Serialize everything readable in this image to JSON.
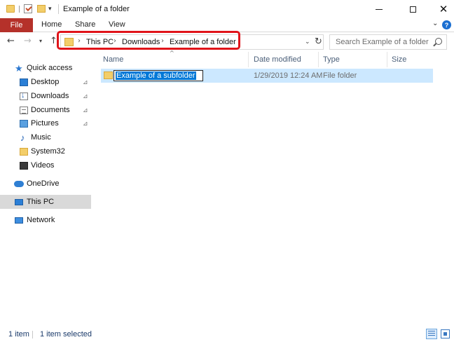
{
  "window": {
    "title": "Example of a folder",
    "minimize_icon": "minimize-icon",
    "maximize_icon": "maximize-icon",
    "close_glyph": "✕"
  },
  "ribbon": {
    "tabs": [
      {
        "label": "File"
      },
      {
        "label": "Home"
      },
      {
        "label": "Share"
      },
      {
        "label": "View"
      }
    ],
    "expand_glyph": "⌄",
    "help_glyph": "?",
    "file_tab_color": "#b5312a"
  },
  "navigation": {
    "back_glyph": "←",
    "forward_glyph": "→",
    "recent_glyph": "▾",
    "up_glyph": "↑"
  },
  "address_bar": {
    "breadcrumbs": [
      "This PC",
      "Downloads",
      "Example of a folder"
    ],
    "separator": "›",
    "dropdown_glyph": "⌄",
    "refresh_glyph": "↻",
    "highlight_color": "#e0141a"
  },
  "search": {
    "placeholder": "Search Example of a folder"
  },
  "nav_pane": {
    "items": [
      {
        "label": "Quick access",
        "icon": "star-icon"
      },
      {
        "label": "Desktop",
        "icon": "desktop-icon",
        "pinned": true
      },
      {
        "label": "Downloads",
        "icon": "downloads-icon",
        "pinned": true
      },
      {
        "label": "Documents",
        "icon": "documents-icon",
        "pinned": true
      },
      {
        "label": "Pictures",
        "icon": "pictures-icon",
        "pinned": true
      },
      {
        "label": "Music",
        "icon": "music-icon"
      },
      {
        "label": "System32",
        "icon": "folder-icon"
      },
      {
        "label": "Videos",
        "icon": "videos-icon"
      },
      {
        "label": "OneDrive",
        "icon": "onedrive-icon"
      },
      {
        "label": "This PC",
        "icon": "pc-icon",
        "selected": true
      },
      {
        "label": "Network",
        "icon": "network-icon"
      }
    ],
    "pin_glyph": "📌"
  },
  "file_list": {
    "columns": [
      "Name",
      "Date modified",
      "Type",
      "Size"
    ],
    "sort_glyph": "^",
    "rows": [
      {
        "name": "Example of a subfolder",
        "date_modified": "1/29/2019 12:24 AM",
        "type": "File folder",
        "size": ""
      }
    ],
    "selection_color": "#cce8ff"
  },
  "status_bar": {
    "item_count": "1 item",
    "selected_count": "1 item selected"
  }
}
